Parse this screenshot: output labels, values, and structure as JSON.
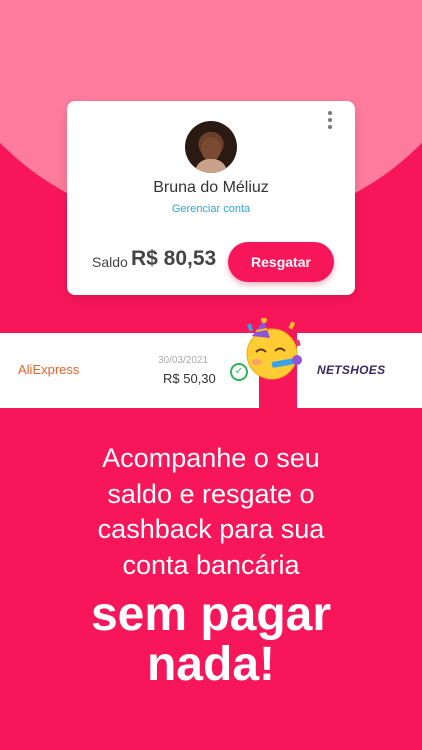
{
  "profile": {
    "name": "Bruna do Méliuz",
    "manage_link": "Gerenciar conta",
    "balance_label": "Saldo",
    "balance_value": "R$ 80,53",
    "redeem_button": "Resgatar"
  },
  "transaction": {
    "store": "AliExpress",
    "date": "30/03/2021",
    "amount": "R$ 50,30",
    "status_icon": "check-circle-icon"
  },
  "next_store": {
    "store": "NETSHOES"
  },
  "headline": {
    "line1": "Acompanhe o seu",
    "line2": "saldo e resgate o",
    "line3": "cashback para sua",
    "line4": "conta bancária"
  },
  "highlight": {
    "line1": "sem pagar",
    "line2": "nada!"
  },
  "colors": {
    "brand": "#f8165a",
    "brand_light": "#ff7c9d",
    "link": "#2da5d9",
    "success": "#2eb45a"
  }
}
